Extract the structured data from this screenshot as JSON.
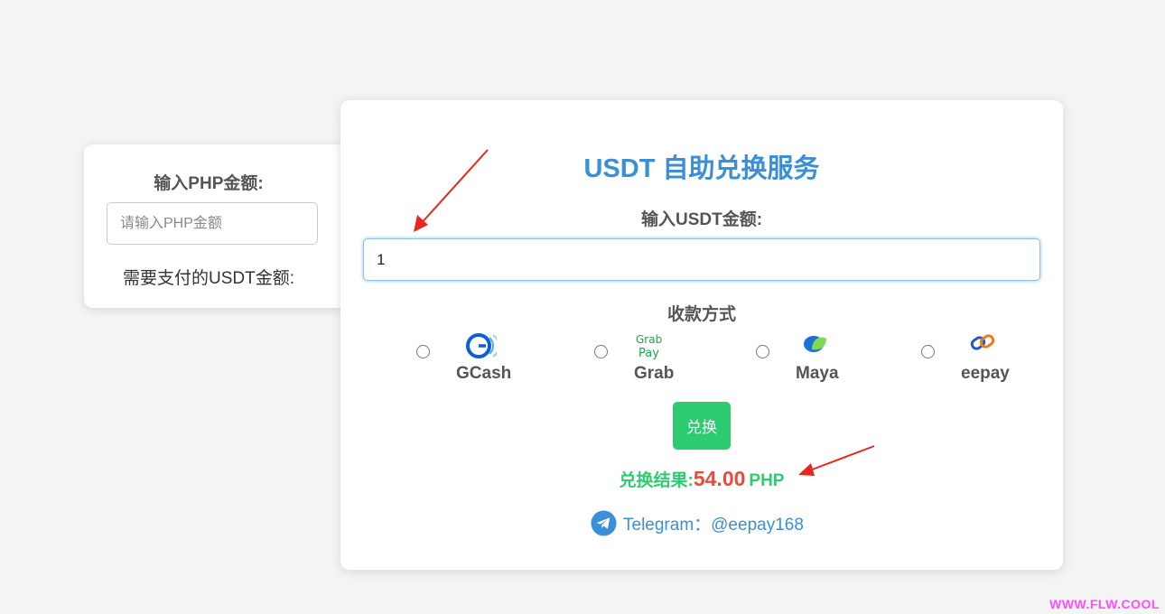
{
  "php_card": {
    "label": "输入PHP金额:",
    "input_placeholder": "请输入PHP金额",
    "result_label": "需要支付的USDT金额:"
  },
  "main_card": {
    "title": "USDT 自助兑换服务",
    "usdt_label": "输入USDT金额:",
    "usdt_value": "1",
    "payment_label": "收款方式",
    "methods": [
      {
        "name": "GCash",
        "icon": "gcash-logo-icon"
      },
      {
        "name": "Grab",
        "icon": "grabpay-logo-icon",
        "logo_text_top": "Grab",
        "logo_text_bottom": "Pay"
      },
      {
        "name": "Maya",
        "icon": "maya-logo-icon"
      },
      {
        "name": "eepay",
        "icon": "eepay-logo-icon"
      }
    ],
    "convert_button": "兑换",
    "result_label": "兑换结果:",
    "result_value": "54.00",
    "result_unit": "PHP",
    "telegram_text": "Telegram：@eepay168"
  },
  "colors": {
    "title_blue": "#3a8fd6",
    "green": "#2ecc71",
    "red": "#e74c3c",
    "annotation_arrow": "#e8261d",
    "watermark": "#ff4df7"
  },
  "watermark": "WWW.FLW.COOL"
}
